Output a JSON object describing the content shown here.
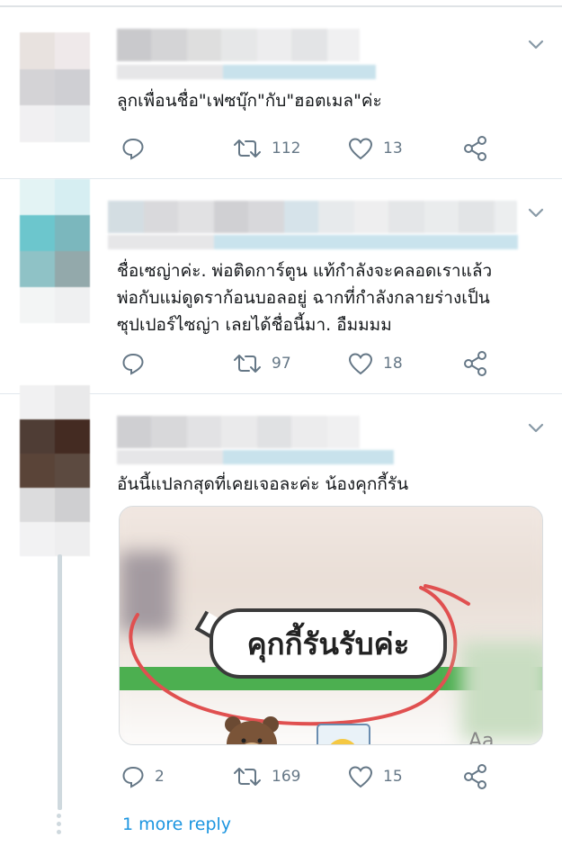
{
  "tweets": [
    {
      "text": "ลูกเพื่อนชื่อ\"เฟซบุ๊ก\"กับ\"ฮอตเมล\"ค่ะ",
      "reply_count": "",
      "retweet_count": "112",
      "like_count": "13"
    },
    {
      "text_lines": [
        "ชื่อเซญ่าค่ะ. พ่อติดการ์ตูน แท้กำลังจะคลอดเราแล้ว",
        "พ่อกับแม่ดูดราก้อนบอลอยู่ ฉากที่กำลังกลายร่างเป็น",
        "ซุปเปอร์ไซญ่า เลยได้ชื่อนี้มา. อืมมมม"
      ],
      "reply_count": "",
      "retweet_count": "97",
      "like_count": "18"
    },
    {
      "text": "อันนี้แปลกสุดที่เคยเจอละค่ะ น้องคุกกี้รัน",
      "media_bubble_text": "คุกกี้รันรับค่ะ",
      "media_corner_text": "Aa",
      "reply_count": "2",
      "retweet_count": "169",
      "like_count": "15"
    }
  ],
  "more_reply_label": "1 more reply",
  "icons": {
    "reply": "reply-icon",
    "retweet": "retweet-icon",
    "like": "heart-icon",
    "share": "share-icon",
    "menu": "chevron-down-icon"
  },
  "colors": {
    "icon_gray": "#657786",
    "link_blue": "#1b95e0",
    "separator": "#e1e8ed"
  }
}
